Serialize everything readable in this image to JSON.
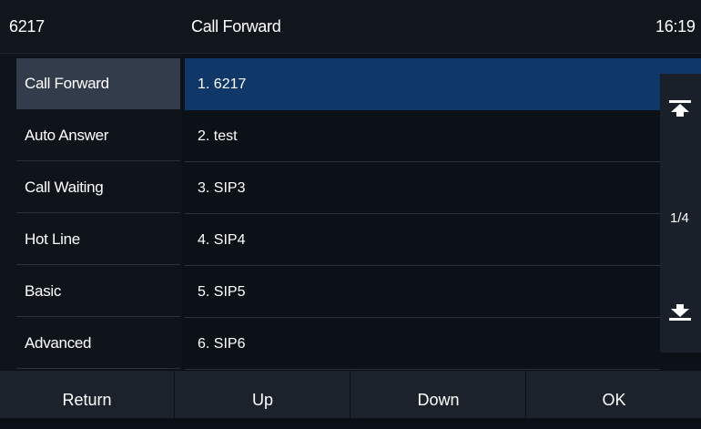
{
  "header": {
    "account": "6217",
    "title": "Call Forward",
    "time": "16:19"
  },
  "sidebar": {
    "items": [
      {
        "label": "Call Forward",
        "active": true
      },
      {
        "label": "Auto Answer"
      },
      {
        "label": "Call Waiting"
      },
      {
        "label": "Hot Line"
      },
      {
        "label": "Basic"
      },
      {
        "label": "Advanced"
      }
    ]
  },
  "list": {
    "items": [
      {
        "label": "1.  6217",
        "active": true
      },
      {
        "label": "2.  test"
      },
      {
        "label": "3.  SIP3"
      },
      {
        "label": "4.  SIP4"
      },
      {
        "label": "5.  SIP5"
      },
      {
        "label": "6.  SIP6"
      }
    ]
  },
  "pager": {
    "page": "1/4",
    "top_icon": "scroll-to-top-icon",
    "bottom_icon": "scroll-to-bottom-icon"
  },
  "softkeys": {
    "return": "Return",
    "up": "Up",
    "down": "Down",
    "ok": "OK"
  },
  "colors": {
    "background": "#0b0f16",
    "selected_row": "#0f3869",
    "selected_sidebar": "#323c4a",
    "softkey_bar": "#1c222b"
  }
}
